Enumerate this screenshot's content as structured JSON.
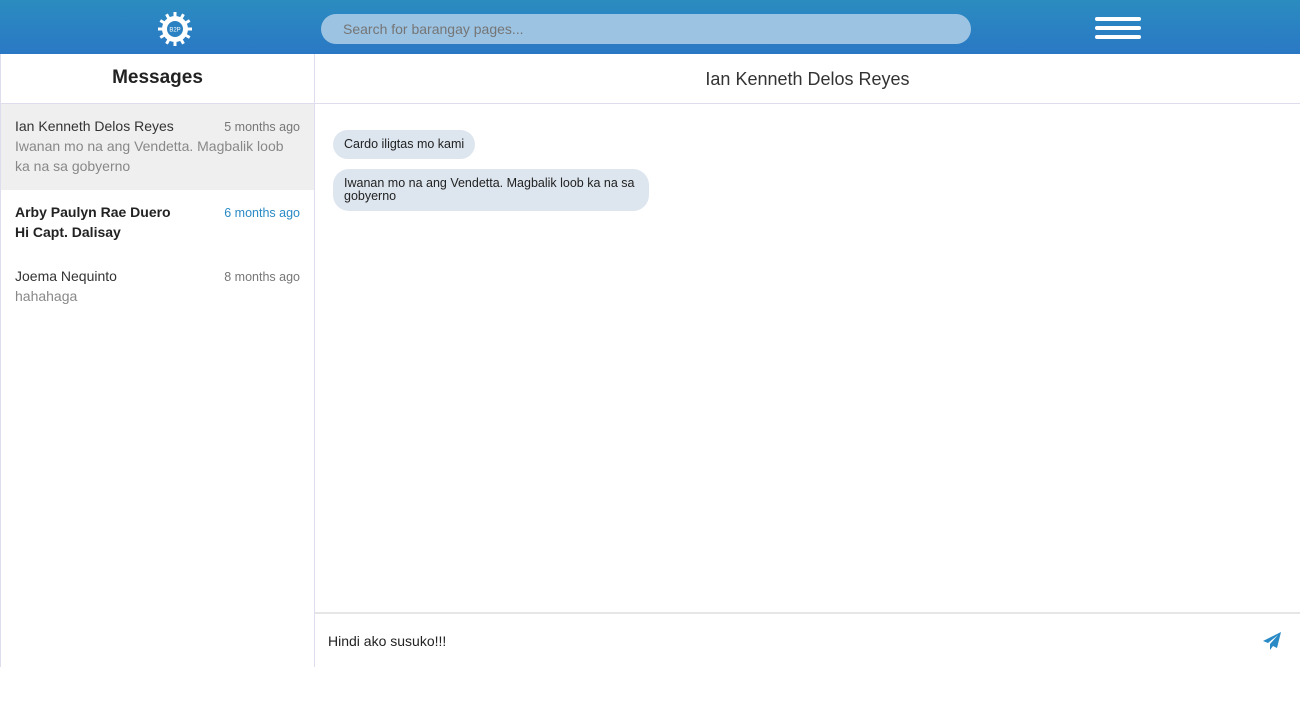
{
  "header": {
    "logo_text": "B2P",
    "search_placeholder": "Search for barangay pages...",
    "brand_color": "#2a82c2"
  },
  "sidebar": {
    "title": "Messages",
    "conversations": [
      {
        "name": "Ian Kenneth Delos Reyes",
        "time": "5 months ago",
        "preview": "Iwanan mo na ang Vendetta. Magbalik loob ka na sa gobyerno"
      },
      {
        "name": "Arby Paulyn Rae Duero",
        "time": "6 months ago",
        "preview": "Hi Capt. Dalisay"
      },
      {
        "name": "Joema Nequinto",
        "time": "8 months ago",
        "preview": "hahahaga"
      }
    ]
  },
  "chat": {
    "title": "Ian Kenneth Delos Reyes",
    "messages": [
      "Cardo iligtas mo kami",
      "Iwanan mo na ang Vendetta. Magbalik loob ka na sa gobyerno"
    ],
    "input_value": "Hindi ako susuko!!!"
  }
}
